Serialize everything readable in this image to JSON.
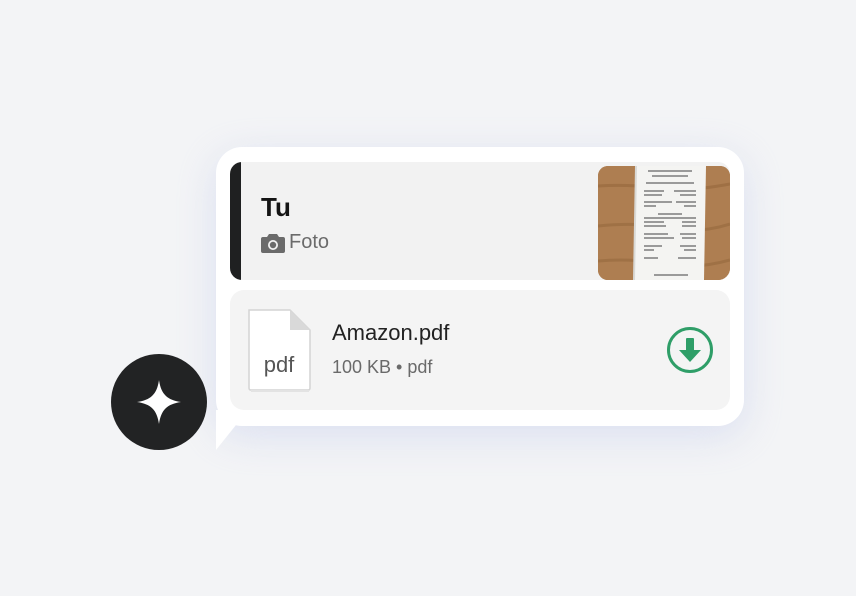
{
  "reply_quote": {
    "sender": "Tu",
    "media_type_label": "Foto",
    "media_icon": "camera-icon",
    "bar_color": "#1f2021"
  },
  "attachment": {
    "file_name": "Amazon.pdf",
    "meta": "100 KB • pdf",
    "icon_extension": "pdf",
    "download_icon": "download-arrow-icon",
    "accent_color": "#2f9e68"
  },
  "assistant": {
    "icon": "sparkle-icon"
  }
}
